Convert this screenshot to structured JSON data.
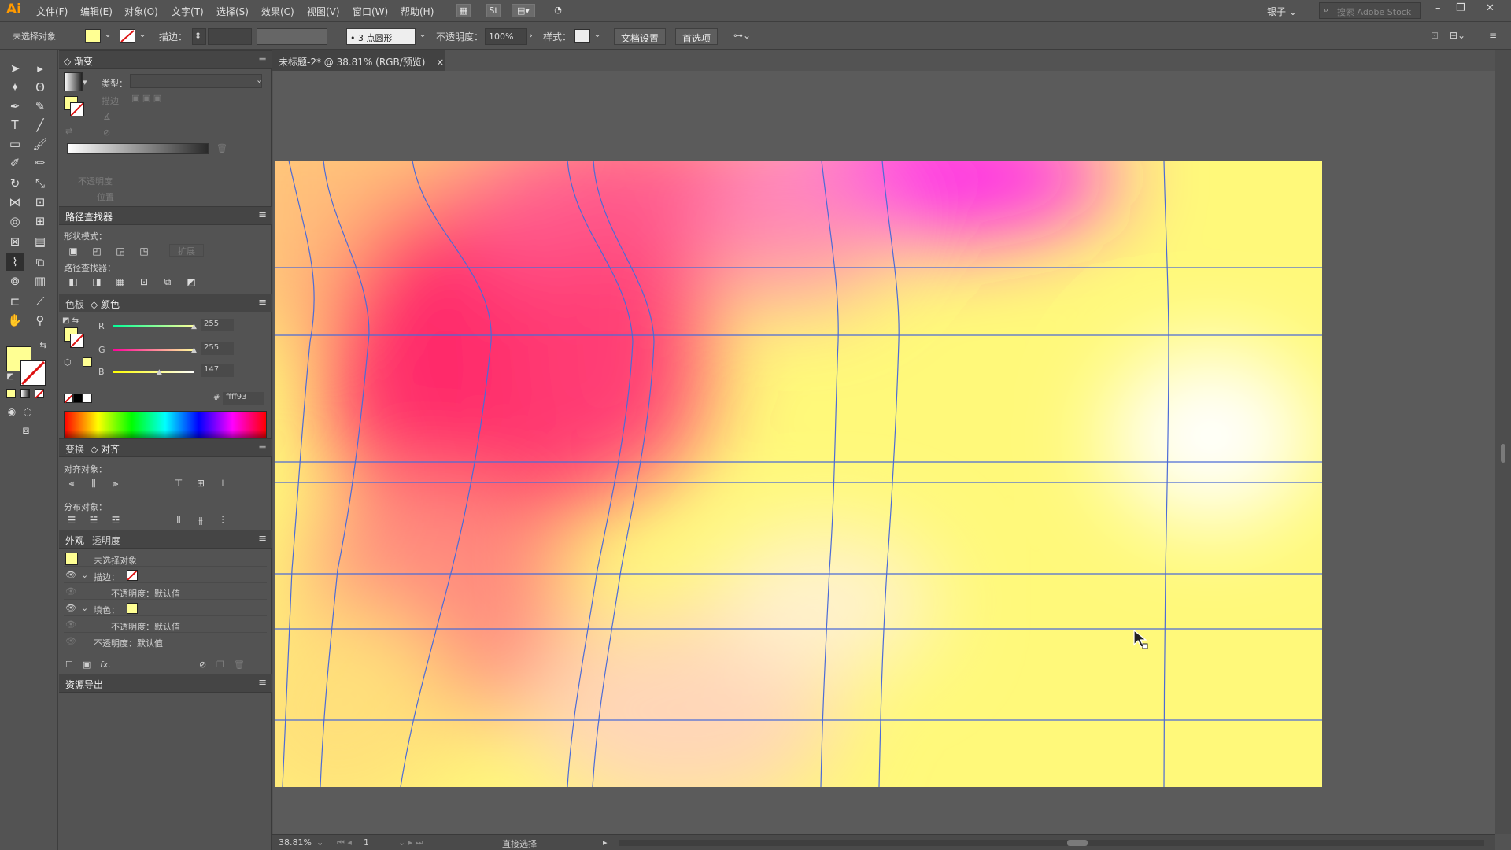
{
  "app": {
    "logo": "Ai"
  },
  "menu": {
    "items": [
      "文件(F)",
      "编辑(E)",
      "对象(O)",
      "文字(T)",
      "选择(S)",
      "效果(C)",
      "视图(V)",
      "窗口(W)",
      "帮助(H)"
    ],
    "st_label": "St",
    "workspace": "银子",
    "search_placeholder": "搜索 Adobe Stock"
  },
  "control": {
    "selection_status": "未选择对象",
    "fill_color": "#ffff93",
    "stroke_label": "描边：",
    "stroke_profile": "3 点圆形",
    "opacity_label": "不透明度：",
    "opacity_value": "100%",
    "style_label": "样式：",
    "doc_setup": "文档设置",
    "preferences": "首选项"
  },
  "gradient_panel": {
    "tab": "渐变",
    "type_label": "类型：",
    "stroke_label": "描边",
    "opacity_label": "不透明度",
    "location_label": "位置"
  },
  "pathfinder_panel": {
    "tab": "路径查找器",
    "shape_modes": "形状模式：",
    "expand": "扩展",
    "pathfinders": "路径查找器："
  },
  "color_panel": {
    "tab_swatches": "色板",
    "tab_color": "颜色",
    "channels": [
      {
        "name": "R",
        "value": "255",
        "level": 1.0
      },
      {
        "name": "G",
        "value": "255",
        "level": 1.0
      },
      {
        "name": "B",
        "value": "147",
        "level": 0.576
      }
    ],
    "hex_prefix": "#",
    "hex": "ffff93"
  },
  "align_panel": {
    "tab_transform": "变换",
    "tab_align": "对齐",
    "align_objects": "对齐对象：",
    "distribute_objects": "分布对象："
  },
  "appearance_panel": {
    "tab_appearance": "外观",
    "tab_transparency": "透明度",
    "rows": {
      "header": "未选择对象",
      "stroke": "描边：",
      "stroke_opacity": "不透明度：默认值",
      "fill": "填色：",
      "fill_opacity": "不透明度：默认值",
      "opacity": "不透明度：默认值"
    }
  },
  "asset_export": {
    "tab": "资源导出"
  },
  "document": {
    "tab_title": "未标题-2* @ 38.81% (RGB/预览)",
    "close": "×"
  },
  "status": {
    "zoom": "38.81%",
    "page": "1",
    "tool": "直接选择"
  },
  "colors": {
    "ui_bg": "#535353",
    "accent": "#ff9a00",
    "mesh_line": "#4c6bd6"
  }
}
